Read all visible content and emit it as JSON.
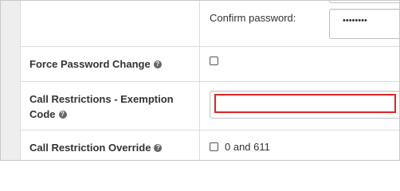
{
  "form": {
    "confirm_password": {
      "label": "Confirm password:",
      "masked_value": "••••••••"
    },
    "force_password_change": {
      "label": "Force Password Change",
      "checked": false
    },
    "call_restrictions_exemption_code": {
      "label_line1": "Call Restrictions - Exemption",
      "label_line2": "Code",
      "value": "",
      "highlight_color": "#e02525"
    },
    "call_restriction_override": {
      "label": "Call Restriction Override",
      "option_label": "0 and 611",
      "checked": false
    }
  },
  "icons": {
    "help": "?"
  }
}
